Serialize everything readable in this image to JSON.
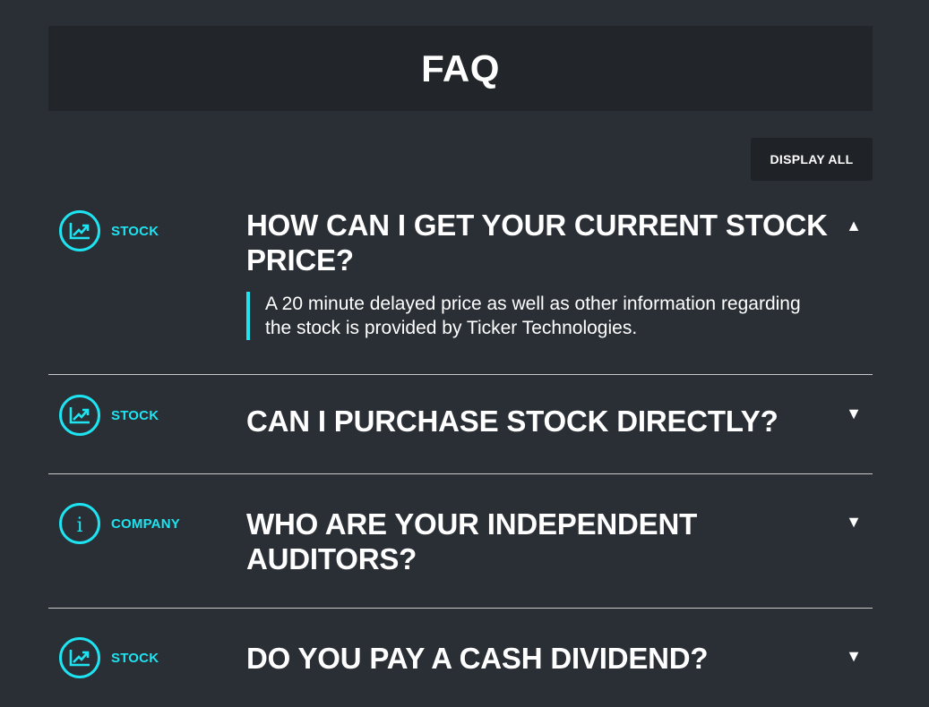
{
  "header": {
    "title": "FAQ"
  },
  "toolbar": {
    "display_all_label": "DISPLAY ALL"
  },
  "colors": {
    "accent": "#1ee3f0",
    "background": "#2a2e35",
    "header_bg": "#22262a"
  },
  "faq": [
    {
      "category": "STOCK",
      "icon": "chart-up-icon",
      "question": "HOW CAN I GET YOUR CURRENT STOCK PRICE?",
      "answer": "A 20 minute delayed price as well as other information regarding the stock is provided by Ticker Technologies.",
      "expanded": true,
      "toggle": "▲"
    },
    {
      "category": "STOCK",
      "icon": "chart-up-icon",
      "question": "CAN I PURCHASE STOCK DIRECTLY?",
      "expanded": false,
      "toggle": "▼"
    },
    {
      "category": "COMPANY",
      "icon": "info-icon",
      "question": "WHO ARE YOUR INDEPENDENT AUDITORS?",
      "expanded": false,
      "toggle": "▼"
    },
    {
      "category": "STOCK",
      "icon": "chart-up-icon",
      "question": "DO YOU PAY A CASH DIVIDEND?",
      "expanded": false,
      "toggle": "▼"
    }
  ]
}
